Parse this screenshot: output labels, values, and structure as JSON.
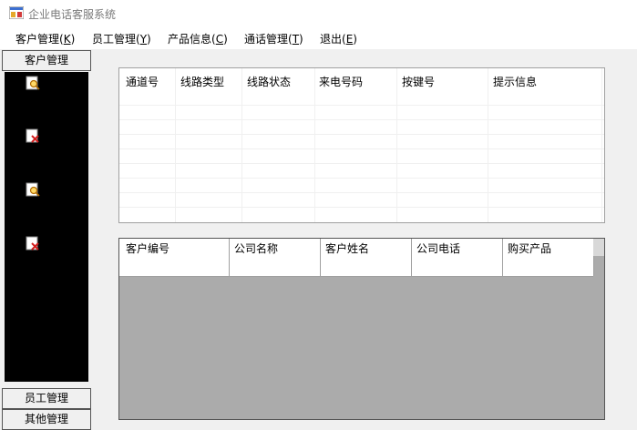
{
  "window": {
    "title": "企业电话客服系统"
  },
  "menu": [
    {
      "label": "客户管理(",
      "key": "K",
      "tail": ")"
    },
    {
      "label": "员工管理(",
      "key": "Y",
      "tail": ")"
    },
    {
      "label": "产品信息(",
      "key": "C",
      "tail": ")"
    },
    {
      "label": "通话管理(",
      "key": "T",
      "tail": ")"
    },
    {
      "label": "退出(",
      "key": "E",
      "tail": ")"
    }
  ],
  "left_nav": {
    "top_tab": "客户管理",
    "bottom_tabs": [
      "员工管理",
      "其他管理"
    ],
    "icons": [
      "search-record-icon",
      "delete-record-icon",
      "search-record-icon",
      "delete-record-icon"
    ]
  },
  "channel_grid": {
    "columns": [
      "通道号",
      "线路类型",
      "线路状态",
      "来电号码",
      "按键号",
      "提示信息"
    ]
  },
  "customer_grid": {
    "columns": [
      "客户编号",
      "公司名称",
      "客户姓名",
      "公司电话",
      "购买产品"
    ]
  }
}
